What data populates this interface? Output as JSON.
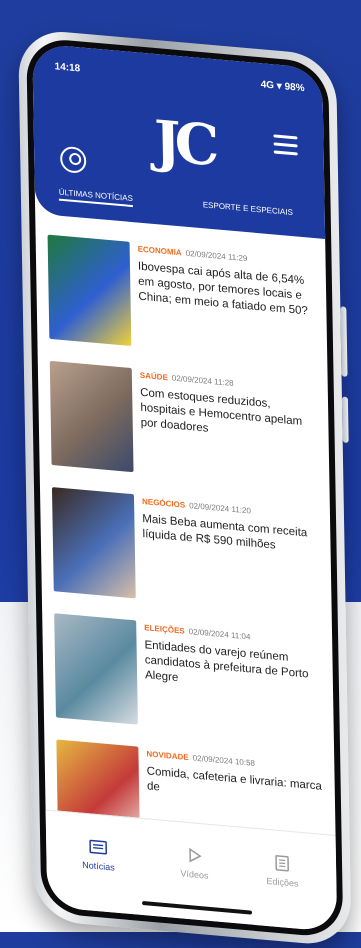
{
  "status_bar": {
    "time": "14:18",
    "right": "4G ▾ 98%"
  },
  "brand": {
    "logo_text": "JC"
  },
  "tabs": [
    {
      "label": "ÚLTIMAS NOTÍCIAS",
      "active": true
    },
    {
      "label": "ESPORTE E ESPECIAIS",
      "active": false
    }
  ],
  "news": [
    {
      "category": "ECONOMIA",
      "datetime": "02/09/2024 11:29",
      "headline": "Ibovespa cai após alta de 6,54% em agosto, por temores locais e China; em meio a fatiado em 50?",
      "thumb_colors": [
        "#1f7a3c",
        "#2f5fd0",
        "#f2d23a"
      ]
    },
    {
      "category": "SAÚDE",
      "datetime": "02/09/2024 11:28",
      "headline": "Com estoques reduzidos, hospitais e Hemocentro apelam por doadores",
      "thumb_colors": [
        "#b9a08c",
        "#7c6a5e",
        "#3b4a6a"
      ]
    },
    {
      "category": "NEGÓCIOS",
      "datetime": "02/09/2024 11:20",
      "headline": "Mais Beba aumenta com receita líquida de R$ 590 milhões",
      "thumb_colors": [
        "#3a2a22",
        "#4a6fb8",
        "#d8c0a8"
      ]
    },
    {
      "category": "ELEIÇÕES",
      "datetime": "02/09/2024 11:04",
      "headline": "Entidades do varejo reúnem candidatos à prefeitura de Porto Alegre",
      "thumb_colors": [
        "#a9b8c4",
        "#5a8aa0",
        "#d8dde2"
      ]
    },
    {
      "category": "NOVIDADE",
      "datetime": "02/09/2024 10:58",
      "headline": "Comida, cafeteria e livraria: marca de",
      "thumb_colors": [
        "#e6b842",
        "#c43a3a",
        "#f4efe6"
      ]
    }
  ],
  "bottom_nav": [
    {
      "label": "Notícias",
      "active": true
    },
    {
      "label": "Vídeos",
      "active": false
    },
    {
      "label": "Edições",
      "active": false
    }
  ],
  "colors": {
    "brand_blue": "#1c3aa0",
    "category_orange": "#f26a21"
  }
}
